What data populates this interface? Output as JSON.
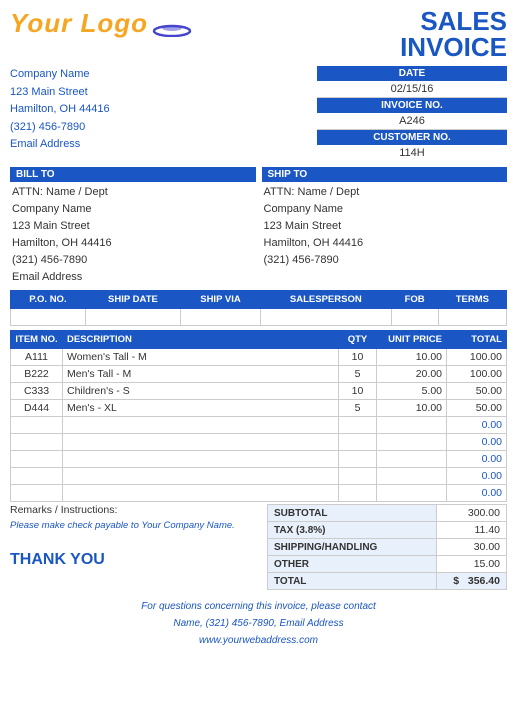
{
  "logo": {
    "text": "Your Logo",
    "swoosh_color": "#4444cc"
  },
  "title": {
    "line1": "SALES",
    "line2": "INVOICE"
  },
  "company": {
    "name": "Company Name",
    "address": "123 Main Street",
    "city": "Hamilton, OH  44416",
    "phone": "(321) 456-7890",
    "email": "Email Address"
  },
  "invoice_meta": {
    "date_label": "DATE",
    "date_value": "02/15/16",
    "invoice_label": "INVOICE NO.",
    "invoice_value": "A246",
    "customer_label": "CUSTOMER NO.",
    "customer_value": "114H"
  },
  "bill_to": {
    "header": "BILL TO",
    "attn": "ATTN: Name / Dept",
    "company": "Company Name",
    "address": "123 Main Street",
    "city": "Hamilton, OH  44416",
    "phone": "(321) 456-7890",
    "email": "Email Address"
  },
  "ship_to": {
    "header": "SHIP TO",
    "attn": "ATTN: Name / Dept",
    "company": "Company Name",
    "address": "123 Main Street",
    "city": "Hamilton, OH  44416",
    "phone": "(321) 456-7890"
  },
  "po_table": {
    "headers": [
      "P.O. NO.",
      "SHIP DATE",
      "SHIP VIA",
      "SALESPERSON",
      "FOB",
      "TERMS"
    ],
    "row": [
      "",
      "",
      "",
      "",
      "",
      ""
    ]
  },
  "items_table": {
    "headers": [
      "ITEM NO.",
      "DESCRIPTION",
      "QTY",
      "UNIT PRICE",
      "TOTAL"
    ],
    "rows": [
      {
        "item": "A111",
        "desc": "Women's Tall - M",
        "qty": "10",
        "unit": "10.00",
        "total": "100.00"
      },
      {
        "item": "B222",
        "desc": "Men's Tall - M",
        "qty": "5",
        "unit": "20.00",
        "total": "100.00"
      },
      {
        "item": "C333",
        "desc": "Children's - S",
        "qty": "10",
        "unit": "5.00",
        "total": "50.00"
      },
      {
        "item": "D444",
        "desc": "Men's - XL",
        "qty": "5",
        "unit": "10.00",
        "total": "50.00"
      },
      {
        "item": "",
        "desc": "",
        "qty": "",
        "unit": "",
        "total": "0.00"
      },
      {
        "item": "",
        "desc": "",
        "qty": "",
        "unit": "",
        "total": "0.00"
      },
      {
        "item": "",
        "desc": "",
        "qty": "",
        "unit": "",
        "total": "0.00"
      },
      {
        "item": "",
        "desc": "",
        "qty": "",
        "unit": "",
        "total": "0.00"
      },
      {
        "item": "",
        "desc": "",
        "qty": "",
        "unit": "",
        "total": "0.00"
      }
    ]
  },
  "totals": {
    "subtotal_label": "SUBTOTAL",
    "subtotal_value": "300.00",
    "tax_label": "TAX (3.8%)",
    "tax_value": "11.40",
    "shipping_label": "SHIPPING/HANDLING",
    "shipping_value": "30.00",
    "other_label": "OTHER",
    "other_value": "15.00",
    "total_label": "TOTAL",
    "total_dollar": "$",
    "total_value": "356.40"
  },
  "remarks": {
    "label": "Remarks / Instructions:"
  },
  "footer": {
    "check_payable": "Please make check payable to Your Company Name.",
    "thank_you": "THANK YOU",
    "contact_line1": "For questions concerning this invoice, please contact",
    "contact_line2": "Name, (321) 456-7890, Email Address",
    "website": "www.yourwebaddress.com"
  }
}
